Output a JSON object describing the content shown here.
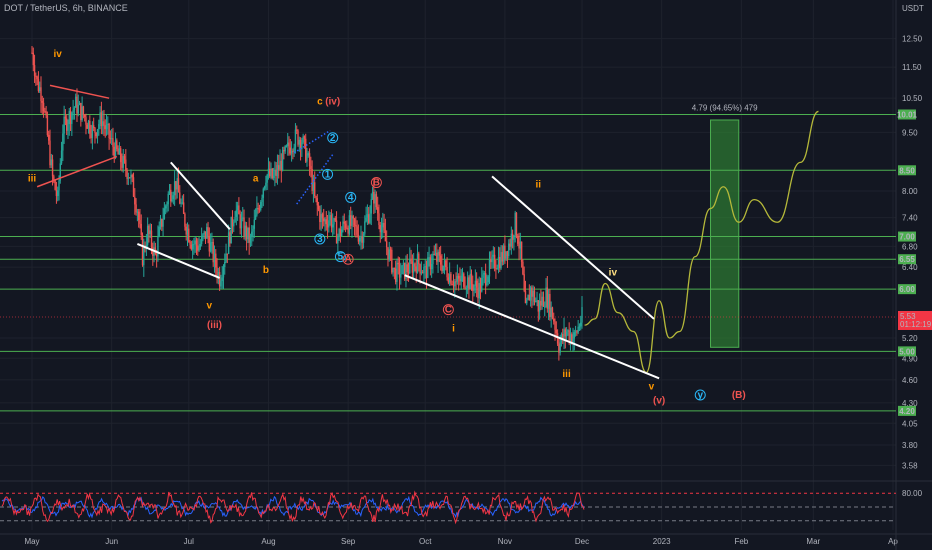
{
  "header": {
    "symbol_line": "DOT / TetherUS, 6h, BINANCE"
  },
  "colors": {
    "background": "#131722",
    "grid": "#1e222d",
    "level_line": "#4caf50",
    "level_badge": "#4caf50",
    "price_badge": "#f23645",
    "trendline": "#ffffff",
    "wave_orange": "#ff9800",
    "wave_red": "#ef5350",
    "wave_yellow": "#ffe082",
    "wave_blue": "#29b6f6",
    "projection_path": "#b5b83a",
    "target_box": "#2e7d32",
    "candle_up": "#26a69a",
    "candle_down": "#ef5350",
    "osc_red": "#f23645",
    "osc_blue": "#2962ff"
  },
  "chart_data": {
    "type": "candlestick",
    "title": "DOT / TetherUS, 6h, BINANCE",
    "y_axis": {
      "unit_label": "USDT",
      "scale": "log",
      "ticks": [
        "12.50",
        "11.50",
        "10.50",
        "9.50",
        "8.00",
        "7.40",
        "6.80",
        "6.40",
        "5.20",
        "4.90",
        "4.60",
        "4.30",
        "4.05",
        "3.80",
        "3.58"
      ],
      "tick_values": [
        12.5,
        11.5,
        10.5,
        9.5,
        8.0,
        7.4,
        6.8,
        6.4,
        5.2,
        4.9,
        4.6,
        4.3,
        4.05,
        3.8,
        3.58
      ],
      "range": [
        3.45,
        14.0
      ]
    },
    "x_axis": {
      "ticks": [
        "May",
        "Jun",
        "Jul",
        "Aug",
        "Sep",
        "Oct",
        "Nov",
        "Dec",
        "2023",
        "Feb",
        "Mar",
        "Ap"
      ],
      "range": [
        "2022-05-01",
        "2023-04-01"
      ]
    },
    "close_series": [
      [
        "2022-05-01",
        12.0
      ],
      [
        "2022-05-03",
        11.0
      ],
      [
        "2022-05-05",
        10.6
      ],
      [
        "2022-05-07",
        9.4
      ],
      [
        "2022-05-09",
        8.3
      ],
      [
        "2022-05-11",
        7.8
      ],
      [
        "2022-05-13",
        9.6
      ],
      [
        "2022-05-15",
        9.9
      ],
      [
        "2022-05-18",
        10.3
      ],
      [
        "2022-05-21",
        10.0
      ],
      [
        "2022-05-25",
        9.5
      ],
      [
        "2022-05-28",
        9.9
      ],
      [
        "2022-06-01",
        9.2
      ],
      [
        "2022-06-05",
        8.7
      ],
      [
        "2022-06-08",
        8.4
      ],
      [
        "2022-06-11",
        7.6
      ],
      [
        "2022-06-13",
        6.6
      ],
      [
        "2022-06-15",
        7.1
      ],
      [
        "2022-06-18",
        6.6
      ],
      [
        "2022-06-20",
        7.2
      ],
      [
        "2022-06-23",
        7.9
      ],
      [
        "2022-06-26",
        8.2
      ],
      [
        "2022-06-29",
        7.4
      ],
      [
        "2022-07-02",
        6.9
      ],
      [
        "2022-07-05",
        6.8
      ],
      [
        "2022-07-08",
        7.1
      ],
      [
        "2022-07-11",
        6.5
      ],
      [
        "2022-07-13",
        6.2
      ],
      [
        "2022-07-16",
        6.8
      ],
      [
        "2022-07-19",
        7.6
      ],
      [
        "2022-07-22",
        7.2
      ],
      [
        "2022-07-25",
        6.9
      ],
      [
        "2022-07-28",
        7.6
      ],
      [
        "2022-07-31",
        8.4
      ],
      [
        "2022-08-03",
        8.3
      ],
      [
        "2022-08-06",
        8.7
      ],
      [
        "2022-08-09",
        9.1
      ],
      [
        "2022-08-12",
        9.4
      ],
      [
        "2022-08-14",
        9.3
      ],
      [
        "2022-08-17",
        8.6
      ],
      [
        "2022-08-19",
        7.8
      ],
      [
        "2022-08-22",
        7.3
      ],
      [
        "2022-08-25",
        7.4
      ],
      [
        "2022-08-28",
        7.0
      ],
      [
        "2022-08-31",
        7.3
      ],
      [
        "2022-09-03",
        7.2
      ],
      [
        "2022-09-06",
        7.0
      ],
      [
        "2022-09-09",
        7.5
      ],
      [
        "2022-09-11",
        7.9
      ],
      [
        "2022-09-13",
        7.4
      ],
      [
        "2022-09-16",
        6.8
      ],
      [
        "2022-09-19",
        6.3
      ],
      [
        "2022-09-22",
        6.3
      ],
      [
        "2022-09-25",
        6.4
      ],
      [
        "2022-09-28",
        6.5
      ],
      [
        "2022-10-01",
        6.3
      ],
      [
        "2022-10-04",
        6.6
      ],
      [
        "2022-10-07",
        6.5
      ],
      [
        "2022-10-10",
        6.3
      ],
      [
        "2022-10-13",
        6.1
      ],
      [
        "2022-10-16",
        6.2
      ],
      [
        "2022-10-19",
        6.1
      ],
      [
        "2022-10-22",
        6.0
      ],
      [
        "2022-10-25",
        6.3
      ],
      [
        "2022-10-28",
        6.5
      ],
      [
        "2022-10-31",
        6.6
      ],
      [
        "2022-11-03",
        6.9
      ],
      [
        "2022-11-05",
        7.3
      ],
      [
        "2022-11-07",
        6.7
      ],
      [
        "2022-11-09",
        5.6
      ],
      [
        "2022-11-11",
        6.0
      ],
      [
        "2022-11-14",
        5.7
      ],
      [
        "2022-11-17",
        5.9
      ],
      [
        "2022-11-20",
        5.5
      ],
      [
        "2022-11-22",
        5.1
      ],
      [
        "2022-11-25",
        5.3
      ],
      [
        "2022-11-28",
        5.2
      ],
      [
        "2022-12-01",
        5.53
      ]
    ],
    "last_price": "5.53",
    "countdown": "01:12:19",
    "horizontal_levels": [
      {
        "value": 10.01,
        "label": "10.01"
      },
      {
        "value": 8.5,
        "label": "8.50"
      },
      {
        "value": 7.0,
        "label": "7.00"
      },
      {
        "value": 6.55,
        "label": "6.55"
      },
      {
        "value": 6.0,
        "label": "6.00"
      },
      {
        "value": 5.0,
        "label": "5.00"
      },
      {
        "value": 4.2,
        "label": "4.20"
      }
    ],
    "target_box": {
      "label": "4.79 (94.65%) 479",
      "from_date": "2023-01-20",
      "to_date": "2023-01-31",
      "from_value": 5.06,
      "to_value": 9.85
    },
    "projection_path": [
      [
        "2022-12-02",
        5.4
      ],
      [
        "2022-12-06",
        5.5
      ],
      [
        "2022-12-10",
        6.1
      ],
      [
        "2022-12-15",
        5.6
      ],
      [
        "2022-12-21",
        5.3
      ],
      [
        "2022-12-26",
        4.7
      ],
      [
        "2022-12-31",
        5.8
      ],
      [
        "2023-01-04",
        5.2
      ],
      [
        "2023-01-08",
        5.3
      ],
      [
        "2023-01-14",
        6.6
      ],
      [
        "2023-01-20",
        7.6
      ],
      [
        "2023-01-25",
        8.1
      ],
      [
        "2023-01-31",
        7.3
      ],
      [
        "2023-02-06",
        7.8
      ],
      [
        "2023-02-15",
        7.3
      ],
      [
        "2023-02-24",
        8.7
      ],
      [
        "2023-03-03",
        10.1
      ]
    ],
    "trendlines": [
      {
        "color": "red",
        "from": [
          "2022-05-08",
          10.9
        ],
        "to": [
          "2022-05-31",
          10.5
        ]
      },
      {
        "color": "red",
        "from": [
          "2022-05-03",
          8.1
        ],
        "to": [
          "2022-06-03",
          8.85
        ]
      },
      {
        "color": "white",
        "from": [
          "2022-06-24",
          8.7
        ],
        "to": [
          "2022-07-17",
          7.15
        ]
      },
      {
        "color": "white",
        "from": [
          "2022-06-11",
          6.85
        ],
        "to": [
          "2022-07-13",
          6.2
        ]
      },
      {
        "color": "blue",
        "from": [
          "2022-08-11",
          8.95
        ],
        "to": [
          "2022-08-25",
          9.55
        ]
      },
      {
        "color": "blue",
        "from": [
          "2022-08-12",
          7.7
        ],
        "to": [
          "2022-08-26",
          8.9
        ]
      },
      {
        "color": "white",
        "from": [
          "2022-09-23",
          6.25
        ],
        "to": [
          "2022-12-31",
          4.62
        ]
      },
      {
        "color": "white",
        "from": [
          "2022-10-27",
          8.35
        ],
        "to": [
          "2022-12-29",
          5.5
        ]
      }
    ],
    "wave_labels": [
      {
        "text": "iv",
        "color": "orange",
        "date": "2022-05-11",
        "value": 11.95,
        "circled": false
      },
      {
        "text": "iii",
        "color": "orange",
        "date": "2022-05-01",
        "value": 8.3,
        "circled": false
      },
      {
        "text": "c",
        "color": "orange",
        "date": "2022-08-21",
        "value": 10.4,
        "circled": false
      },
      {
        "text": "(iv)",
        "color": "red",
        "date": "2022-08-26",
        "value": 10.4,
        "circled": false
      },
      {
        "text": "a",
        "color": "orange",
        "date": "2022-07-27",
        "value": 8.3,
        "circled": false
      },
      {
        "text": "b",
        "color": "orange",
        "date": "2022-07-31",
        "value": 6.35,
        "circled": false
      },
      {
        "text": "v",
        "color": "orange",
        "date": "2022-07-09",
        "value": 5.72,
        "circled": false
      },
      {
        "text": "(iii)",
        "color": "red",
        "date": "2022-07-11",
        "value": 5.4,
        "circled": false
      },
      {
        "text": "2",
        "color": "blue",
        "date": "2022-08-26",
        "value": 9.35,
        "circled": true
      },
      {
        "text": "1",
        "color": "blue",
        "date": "2022-08-24",
        "value": 8.4,
        "circled": true
      },
      {
        "text": "4",
        "color": "blue",
        "date": "2022-09-02",
        "value": 7.85,
        "circled": true
      },
      {
        "text": "3",
        "color": "blue",
        "date": "2022-08-21",
        "value": 6.95,
        "circled": true
      },
      {
        "text": "5",
        "color": "blue",
        "date": "2022-08-29",
        "value": 6.6,
        "circled": true
      },
      {
        "text": "A",
        "color": "red",
        "date": "2022-09-01",
        "value": 6.55,
        "circled": true
      },
      {
        "text": "B",
        "color": "red",
        "date": "2022-09-12",
        "value": 8.2,
        "circled": true
      },
      {
        "text": "C",
        "color": "red",
        "date": "2022-10-10",
        "value": 5.65,
        "circled": true
      },
      {
        "text": "i",
        "color": "orange",
        "date": "2022-10-12",
        "value": 5.35,
        "circled": false
      },
      {
        "text": "ii",
        "color": "orange",
        "date": "2022-11-14",
        "value": 8.15,
        "circled": false
      },
      {
        "text": "iii",
        "color": "orange",
        "date": "2022-11-25",
        "value": 4.68,
        "circled": false
      },
      {
        "text": "iv",
        "color": "yellow",
        "date": "2022-12-13",
        "value": 6.3,
        "circled": false
      },
      {
        "text": "v",
        "color": "orange",
        "date": "2022-12-28",
        "value": 4.51,
        "circled": false
      },
      {
        "text": "(v)",
        "color": "red",
        "date": "2022-12-31",
        "value": 4.33,
        "circled": false
      },
      {
        "text": "y",
        "color": "blue",
        "date": "2023-01-16",
        "value": 4.4,
        "circled": true
      },
      {
        "text": "(B)",
        "color": "red",
        "date": "2023-01-31",
        "value": 4.4,
        "circled": false
      }
    ],
    "oscillator": {
      "ticks": [
        "80.00"
      ],
      "levels": [
        80,
        50,
        20
      ],
      "range": [
        0,
        100
      ]
    }
  }
}
